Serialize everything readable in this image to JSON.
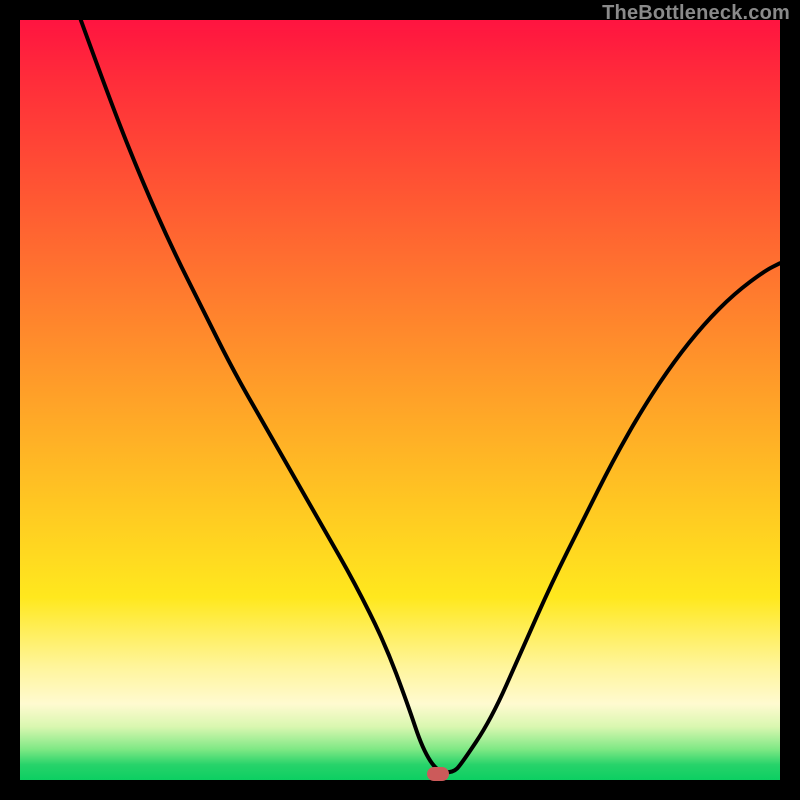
{
  "watermark": "TheBottleneck.com",
  "colors": {
    "frame": "#000000",
    "curve_stroke": "#000000",
    "marker": "#cc5a5a",
    "watermark": "#8a8a8a"
  },
  "chart_data": {
    "type": "line",
    "title": "",
    "xlabel": "",
    "ylabel": "",
    "xlim": [
      0,
      100
    ],
    "ylim": [
      0,
      100
    ],
    "grid": false,
    "legend": "none",
    "series": [
      {
        "name": "bottleneck-curve",
        "x": [
          8,
          12,
          16,
          20,
          24,
          28,
          32,
          36,
          40,
          44,
          48,
          51,
          53,
          55,
          57,
          58,
          62,
          66,
          70,
          74,
          78,
          82,
          86,
          90,
          94,
          98,
          100
        ],
        "y": [
          100,
          89,
          79,
          70,
          62,
          54,
          47,
          40,
          33,
          26,
          18,
          10,
          4,
          1,
          1,
          2,
          8,
          17,
          26,
          34,
          42,
          49,
          55,
          60,
          64,
          67,
          68
        ]
      }
    ],
    "annotations": [
      {
        "name": "min-marker",
        "x": 55,
        "y": 0.8
      }
    ],
    "background_gradient": {
      "orientation": "vertical",
      "stops": [
        {
          "pos": 0.0,
          "color": "#ff1440"
        },
        {
          "pos": 0.5,
          "color": "#ffa228"
        },
        {
          "pos": 0.8,
          "color": "#ffe81e"
        },
        {
          "pos": 0.93,
          "color": "#d9f7b0"
        },
        {
          "pos": 1.0,
          "color": "#0ccf62"
        }
      ]
    }
  }
}
